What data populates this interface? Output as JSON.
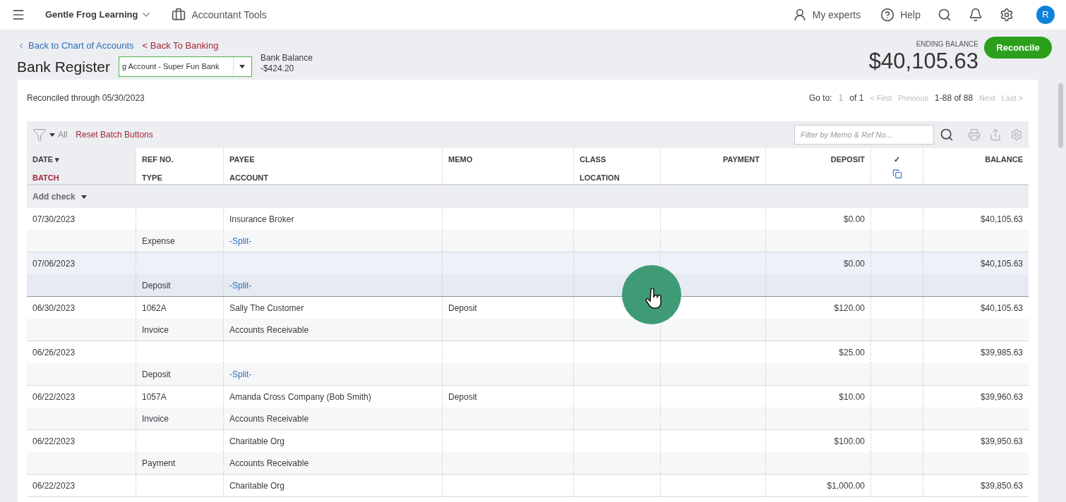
{
  "topbar": {
    "company": "Gentle Frog Learning",
    "tools": "Accountant Tools",
    "experts": "My experts",
    "help": "Help",
    "avatar": "R"
  },
  "header": {
    "back_links": [
      "Back to Chart of Accounts",
      "< Back To Banking"
    ],
    "title": "Bank Register",
    "account": "g Account - Super Fun Bank",
    "bank_balance_label": "Bank Balance",
    "bank_balance": "-$424.20",
    "ending_label": "ENDING BALANCE",
    "ending_balance": "$40,105.63",
    "reconcile": "Reconcile"
  },
  "reconciled": "Reconciled through 05/30/2023",
  "pager": {
    "goto": "Go to:",
    "page": "1",
    "of": "of 1",
    "first": "< First",
    "previous": "Previous",
    "range": "1-88 of 88",
    "next": "Next",
    "last": "Last >"
  },
  "toolbar": {
    "filter": "All",
    "reset": "Reset Batch Buttons",
    "search_placeholder": "Filter by Memo & Ref No..."
  },
  "columns": [
    {
      "top": "DATE ▾",
      "bottom": "BATCH"
    },
    {
      "top": "REF NO.",
      "bottom": "TYPE"
    },
    {
      "top": "PAYEE",
      "bottom": "ACCOUNT"
    },
    {
      "top": "MEMO"
    },
    {
      "top": "CLASS",
      "bottom": "LOCATION"
    },
    {
      "top": "PAYMENT"
    },
    {
      "top": "DEPOSIT"
    },
    {
      "top": "✓"
    },
    {
      "top": "BALANCE"
    }
  ],
  "add_check": "Add check",
  "rows": [
    {
      "date": "07/30/2023",
      "payee": "Insurance Broker",
      "deposit": "$0.00",
      "balance": "$40,105.63",
      "type": "Expense",
      "account": "-Split-",
      "split": true,
      "selected": false
    },
    {
      "date": "07/06/2023",
      "deposit": "$0.00",
      "balance": "$40,105.63",
      "type": "Deposit",
      "account": "-Split-",
      "split": true,
      "selected": true
    },
    {
      "date": "06/30/2023",
      "ref": "1062A",
      "payee": "Sally The Customer",
      "memo": "Deposit",
      "deposit": "$120.00",
      "balance": "$40,105.63",
      "type": "Invoice",
      "account": "Accounts Receivable",
      "split": false,
      "selected": false
    },
    {
      "date": "06/26/2023",
      "deposit": "$25.00",
      "balance": "$39,985.63",
      "type": "Deposit",
      "account": "-Split-",
      "split": true,
      "selected": false
    },
    {
      "date": "06/22/2023",
      "ref": "1057A",
      "payee": "Amanda Cross Company (Bob Smith)",
      "memo": "Deposit",
      "deposit": "$10.00",
      "balance": "$39,960.63",
      "type": "Invoice",
      "account": "Accounts Receivable",
      "split": false,
      "selected": false
    },
    {
      "date": "06/22/2023",
      "payee": "Charitable Org",
      "deposit": "$100.00",
      "balance": "$39,950.63",
      "type": "Payment",
      "account": "Accounts Receivable",
      "split": false,
      "selected": false
    },
    {
      "date": "06/22/2023",
      "payee": "Charitable Org",
      "deposit": "$1,000.00",
      "balance": "$39,850.63",
      "selected": false
    }
  ]
}
